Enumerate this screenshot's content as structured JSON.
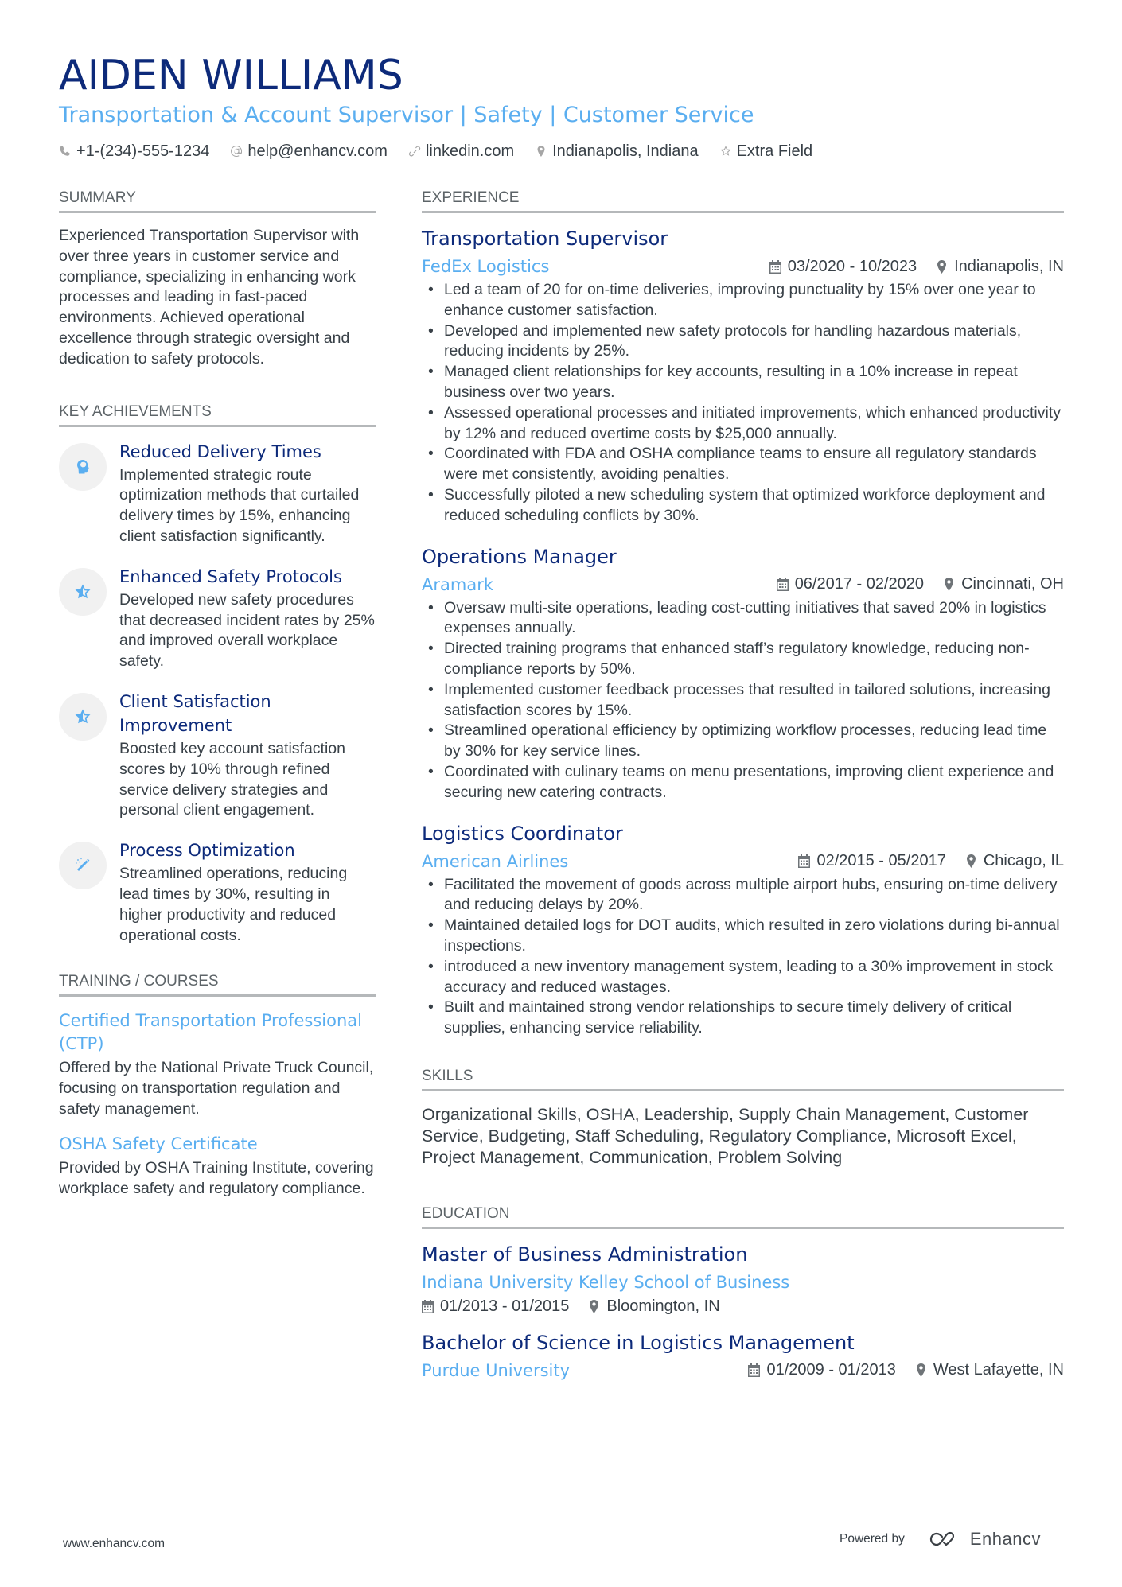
{
  "header": {
    "name": "AIDEN WILLIAMS",
    "title": "Transportation & Account Supervisor | Safety | Customer Service",
    "contacts": [
      {
        "icon": "phone-icon",
        "text": "+1-(234)-555-1234"
      },
      {
        "icon": "at-icon",
        "text": "help@enhancv.com"
      },
      {
        "icon": "link-icon",
        "text": "linkedin.com"
      },
      {
        "icon": "location-icon",
        "text": "Indianapolis, Indiana"
      },
      {
        "icon": "star-icon",
        "text": "Extra Field"
      }
    ]
  },
  "summary": {
    "heading": "SUMMARY",
    "text": "Experienced Transportation Supervisor with over three years in customer service and compliance, specializing in enhancing work processes and leading in fast-paced environments. Achieved operational excellence through strategic oversight and dedication to safety protocols."
  },
  "achievements": {
    "heading": "KEY ACHIEVEMENTS",
    "items": [
      {
        "icon": "brain-head-icon",
        "title": "Reduced Delivery Times",
        "description": "Implemented strategic route optimization methods that curtailed delivery times by 15%, enhancing client satisfaction significantly."
      },
      {
        "icon": "star-half-icon",
        "title": "Enhanced Safety Protocols",
        "description": "Developed new safety procedures that decreased incident rates by 25% and improved overall workplace safety."
      },
      {
        "icon": "star-half-icon",
        "title": "Client Satisfaction Improvement",
        "description": "Boosted key account satisfaction scores by 10% through refined service delivery strategies and personal client engagement."
      },
      {
        "icon": "magic-wand-icon",
        "title": "Process Optimization",
        "description": "Streamlined operations, reducing lead times by 30%, resulting in higher productivity and reduced operational costs."
      }
    ]
  },
  "training": {
    "heading": "TRAINING / COURSES",
    "items": [
      {
        "title": "Certified Transportation Professional (CTP)",
        "description": "Offered by the National Private Truck Council, focusing on transportation regulation and safety management."
      },
      {
        "title": "OSHA Safety Certificate",
        "description": "Provided by OSHA Training Institute, covering workplace safety and regulatory compliance."
      }
    ]
  },
  "experience": {
    "heading": "EXPERIENCE",
    "jobs": [
      {
        "title": "Transportation Supervisor",
        "company": "FedEx Logistics",
        "dates": "03/2020 - 10/2023",
        "location": "Indianapolis, IN",
        "bullets": [
          "Led a team of 20 for on-time deliveries, improving punctuality by 15% over one year to enhance customer satisfaction.",
          "Developed and implemented new safety protocols for handling hazardous materials, reducing incidents by 25%.",
          "Managed client relationships for key accounts, resulting in a 10% increase in repeat business over two years.",
          "Assessed operational processes and initiated improvements, which enhanced productivity by 12% and reduced overtime costs by $25,000 annually.",
          "Coordinated with FDA and OSHA compliance teams to ensure all regulatory standards were met consistently, avoiding penalties.",
          "Successfully piloted a new scheduling system that optimized workforce deployment and reduced scheduling conflicts by 30%."
        ]
      },
      {
        "title": "Operations Manager",
        "company": "Aramark",
        "dates": "06/2017 - 02/2020",
        "location": "Cincinnati, OH",
        "bullets": [
          "Oversaw multi-site operations, leading cost-cutting initiatives that saved 20% in logistics expenses annually.",
          "Directed training programs that enhanced staff’s regulatory knowledge, reducing non-compliance reports by 50%.",
          "Implemented customer feedback processes that resulted in tailored solutions, increasing satisfaction scores by 15%.",
          "Streamlined operational efficiency by optimizing workflow processes, reducing lead time by 30% for key service lines.",
          "Coordinated with culinary teams on menu presentations, improving client experience and securing new catering contracts."
        ]
      },
      {
        "title": "Logistics Coordinator",
        "company": "American Airlines",
        "dates": "02/2015 - 05/2017",
        "location": "Chicago, IL",
        "bullets": [
          "Facilitated the movement of goods across multiple airport hubs, ensuring on-time delivery and reducing delays by 20%.",
          "Maintained detailed logs for DOT audits, which resulted in zero violations during bi-annual inspections.",
          "introduced a new inventory management system, leading to a 30% improvement in stock accuracy and reduced wastages.",
          "Built and maintained strong vendor relationships to secure timely delivery of critical supplies, enhancing service reliability."
        ]
      }
    ]
  },
  "skills": {
    "heading": "SKILLS",
    "text": "Organizational Skills, OSHA, Leadership, Supply Chain Management, Customer Service, Budgeting, Staff Scheduling, Regulatory Compliance, Microsoft Excel, Project Management, Communication, Problem Solving"
  },
  "education": {
    "heading": "EDUCATION",
    "items": [
      {
        "degree": "Master of Business Administration",
        "school": "Indiana University Kelley School of Business",
        "dates": "01/2013 - 01/2015",
        "location": "Bloomington, IN"
      },
      {
        "degree": "Bachelor of Science in Logistics Management",
        "school": "Purdue University",
        "dates": "01/2009 - 01/2013",
        "location": "West Lafayette, IN"
      }
    ]
  },
  "footer": {
    "website": "www.enhancv.com",
    "powered_by": "Powered by",
    "brand": "Enhancv"
  },
  "colors": {
    "name": "#0d2a7a",
    "accent": "#5aaef0",
    "text": "#384047",
    "divider": "#b5b8ba"
  }
}
